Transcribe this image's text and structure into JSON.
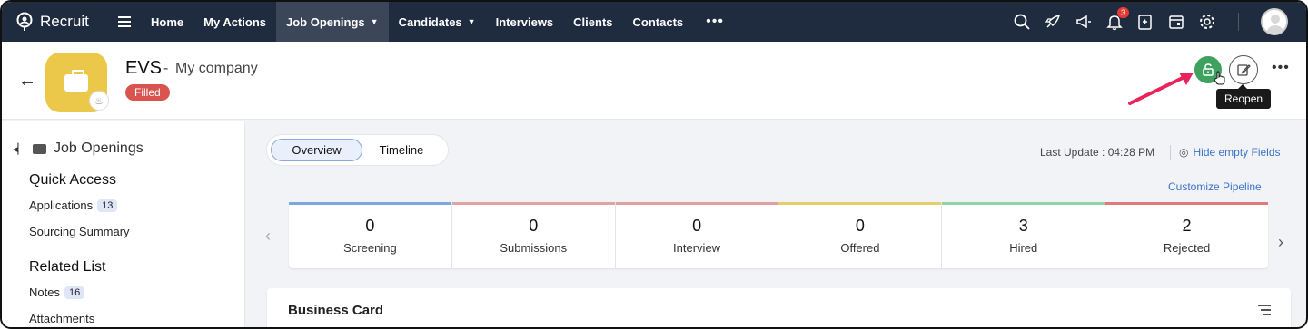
{
  "app": {
    "name": "Recruit"
  },
  "nav": {
    "items": [
      {
        "label": "Home",
        "active": false,
        "dropdown": false
      },
      {
        "label": "My Actions",
        "active": false,
        "dropdown": false
      },
      {
        "label": "Job Openings",
        "active": true,
        "dropdown": true
      },
      {
        "label": "Candidates",
        "active": false,
        "dropdown": true
      },
      {
        "label": "Interviews",
        "active": false,
        "dropdown": false
      },
      {
        "label": "Clients",
        "active": false,
        "dropdown": false
      },
      {
        "label": "Contacts",
        "active": false,
        "dropdown": false
      }
    ],
    "more": "•••",
    "notification_count": "3",
    "icons": [
      "search-icon",
      "rocket-icon",
      "megaphone-icon",
      "bell-icon",
      "add-note-icon",
      "calendar-icon",
      "gear-icon"
    ]
  },
  "record": {
    "title": "EVS",
    "separator": "-",
    "company": "My company",
    "status": "Filled",
    "tooltip": "Reopen",
    "more": "•••"
  },
  "sidebar": {
    "module": "Job Openings",
    "quick_access_title": "Quick Access",
    "applications_label": "Applications",
    "applications_count": "13",
    "sourcing_label": "Sourcing Summary",
    "related_title": "Related List",
    "notes_label": "Notes",
    "notes_count": "16",
    "attachments_label": "Attachments"
  },
  "main": {
    "tabs": [
      "Overview",
      "Timeline"
    ],
    "last_update": "Last Update : 04:28 PM",
    "hide_empty": "Hide empty Fields",
    "customize_pipeline": "Customize Pipeline",
    "business_card_title": "Business Card"
  },
  "pipeline": [
    {
      "label": "Screening",
      "value": "0",
      "color": "#7ea6e0"
    },
    {
      "label": "Submissions",
      "value": "0",
      "color": "#e0a3a3"
    },
    {
      "label": "Interview",
      "value": "0",
      "color": "#e0a0a0"
    },
    {
      "label": "Offered",
      "value": "0",
      "color": "#e6cf6a"
    },
    {
      "label": "Hired",
      "value": "3",
      "color": "#8fd3a8"
    },
    {
      "label": "Rejected",
      "value": "2",
      "color": "#e07b7b"
    }
  ],
  "colors": {
    "nav_bg": "#1f2b3f",
    "status_filled": "#d9534f",
    "reopen_green": "#3fa15f",
    "link_blue": "#3b73c7",
    "annotation_arrow": "#e8245a"
  }
}
